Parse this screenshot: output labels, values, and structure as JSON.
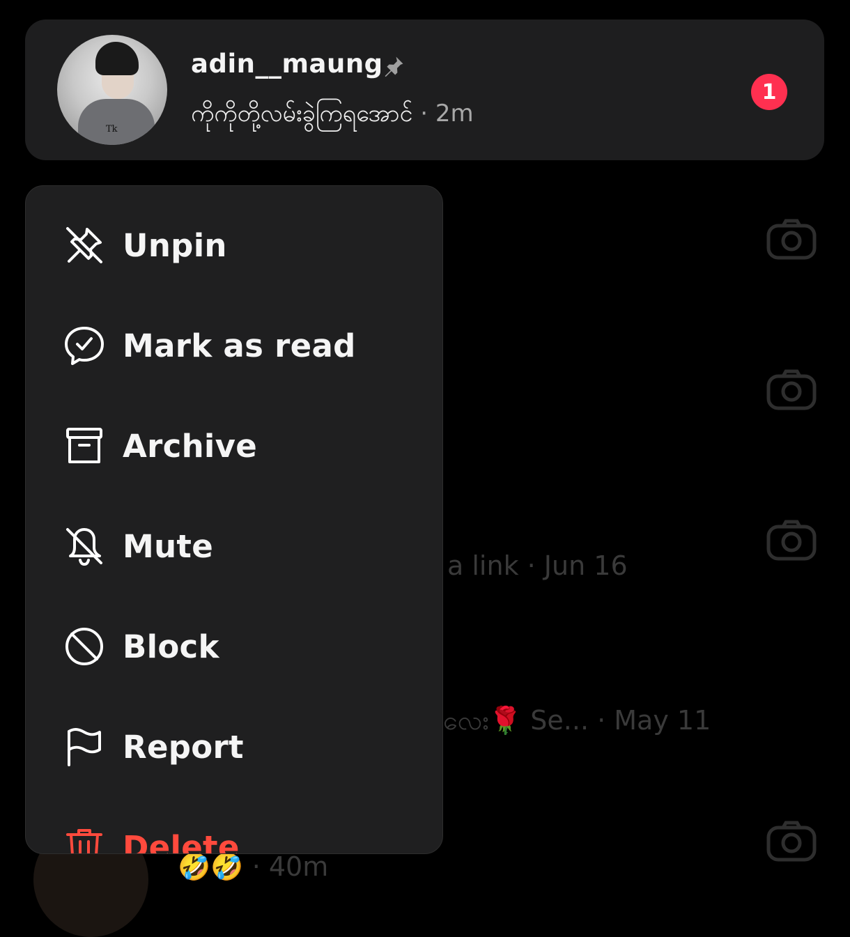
{
  "pinned_thread": {
    "username": "adin__maung",
    "pin_icon": "pin-icon",
    "message_preview": "ကိုကိုတို့လမ်းခွဲကြရအောင်",
    "separator": "·",
    "time": "2m",
    "unread_count": "1",
    "badge_color": "#ff3050"
  },
  "background_threads": [
    {
      "text": "a link · Jun 16"
    },
    {
      "text": "လေး🌹 Se... · May 11"
    },
    {
      "text": "🤣🤣 · 40m"
    }
  ],
  "context_menu": {
    "items": [
      {
        "label": "Unpin",
        "icon": "unpin-icon"
      },
      {
        "label": "Mark as read",
        "icon": "mark-read-icon"
      },
      {
        "label": "Archive",
        "icon": "archive-icon"
      },
      {
        "label": "Mute",
        "icon": "bell-off-icon"
      },
      {
        "label": "Block",
        "icon": "block-icon"
      },
      {
        "label": "Report",
        "icon": "flag-icon"
      },
      {
        "label": "Delete",
        "icon": "trash-icon"
      }
    ],
    "delete_color": "#ff4a3d"
  }
}
